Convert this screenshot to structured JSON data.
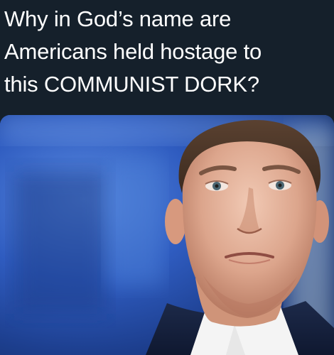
{
  "post": {
    "text_lines": [
      "Why in God’s name are",
      "Americans held hostage to",
      "this COMMUNIST DORK?"
    ]
  },
  "colors": {
    "background": "#15202b",
    "text": "#ffffff",
    "photo_backdrop": "#3a5fb8"
  },
  "media": {
    "type": "photo",
    "subject": "portrait-photo"
  }
}
